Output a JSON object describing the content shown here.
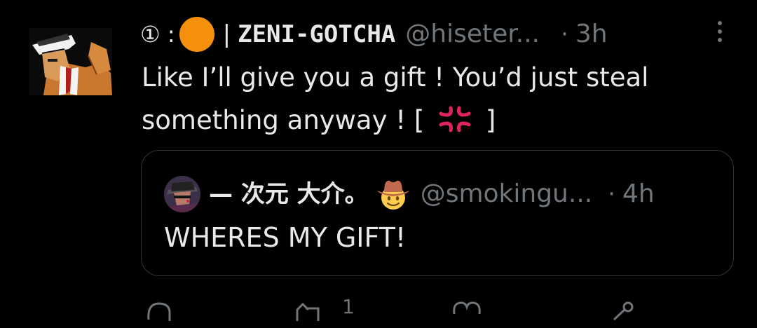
{
  "tweet": {
    "display_prefix": "① :",
    "bar": "|",
    "display_name": "ZENI-GOTCHA",
    "handle": "@hiseter...",
    "separator": "·",
    "time": "3h",
    "body_line1": "Like I’ll give you a gift ! You’d just steal",
    "body_line2_start": "something anyway ! [",
    "body_line2_end": "]",
    "emoji_in_name": "orange-circle",
    "emoji_in_body": "anger-symbol"
  },
  "quoted": {
    "display_name": "— 次元 大介。",
    "emoji": "cowboy-face",
    "handle": "@smokingu...",
    "separator": "·",
    "time": "4h",
    "text": "WHERES MY GIFT!"
  },
  "actions": {
    "reply_icon": "reply-icon",
    "retweet_icon": "retweet-icon",
    "retweet_count": "1",
    "like_icon": "heart-icon",
    "share_icon": "share-icon"
  },
  "colors": {
    "background": "#000000",
    "text": "#e7e9ea",
    "secondary": "#71767b",
    "border": "#2f3336",
    "orange_circle": "#f4900c",
    "anger": "#e0245e"
  }
}
